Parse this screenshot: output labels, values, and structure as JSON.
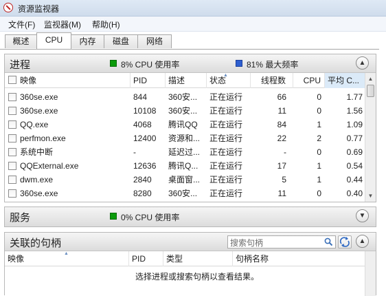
{
  "window": {
    "title": "资源监视器"
  },
  "menu": [
    "文件(F)",
    "监视器(M)",
    "帮助(H)"
  ],
  "tabs": [
    "概述",
    "CPU",
    "内存",
    "磁盘",
    "网络"
  ],
  "processes": {
    "title": "进程",
    "cpu_usage": "8% CPU 使用率",
    "max_freq": "81% 最大频率",
    "columns": [
      "映像",
      "PID",
      "描述",
      "状态",
      "线程数",
      "CPU",
      "平均 C..."
    ],
    "rows": [
      {
        "image": "360se.exe",
        "pid": "844",
        "desc": "360安...",
        "status": "正在运行",
        "threads": "66",
        "cpu": "0",
        "avg": "1.77"
      },
      {
        "image": "360se.exe",
        "pid": "10108",
        "desc": "360安...",
        "status": "正在运行",
        "threads": "11",
        "cpu": "0",
        "avg": "1.56"
      },
      {
        "image": "QQ.exe",
        "pid": "4068",
        "desc": "腾讯QQ",
        "status": "正在运行",
        "threads": "84",
        "cpu": "1",
        "avg": "1.09"
      },
      {
        "image": "perfmon.exe",
        "pid": "12400",
        "desc": "资源和...",
        "status": "正在运行",
        "threads": "22",
        "cpu": "2",
        "avg": "0.77"
      },
      {
        "image": "系统中断",
        "pid": "-",
        "desc": "延迟过...",
        "status": "正在运行",
        "threads": "-",
        "cpu": "0",
        "avg": "0.69"
      },
      {
        "image": "QQExternal.exe",
        "pid": "12636",
        "desc": "腾讯Q...",
        "status": "正在运行",
        "threads": "17",
        "cpu": "1",
        "avg": "0.54"
      },
      {
        "image": "dwm.exe",
        "pid": "2840",
        "desc": "桌面窗...",
        "status": "正在运行",
        "threads": "5",
        "cpu": "1",
        "avg": "0.44"
      },
      {
        "image": "360se.exe",
        "pid": "8280",
        "desc": "360安...",
        "status": "正在运行",
        "threads": "11",
        "cpu": "0",
        "avg": "0.40"
      }
    ]
  },
  "services": {
    "title": "服务",
    "cpu_usage": "0% CPU 使用率"
  },
  "handles": {
    "title": "关联的句柄",
    "search_placeholder": "搜索句柄",
    "columns": [
      "映像",
      "PID",
      "类型",
      "句柄名称"
    ],
    "empty_message": "选择进程或搜索句柄以查看结果。"
  },
  "colors": {
    "cpu_legend": "#0b9b0b",
    "freq_legend": "#2e5fd0",
    "sorted_column": "#dbeaf8"
  }
}
